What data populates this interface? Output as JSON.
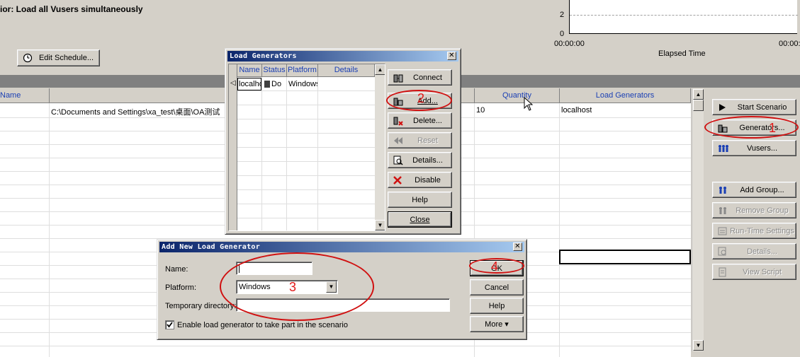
{
  "scenario_title": "ior: Load all Vusers simultaneously",
  "edit_schedule_label": "Edit Schedule...",
  "graph": {
    "y_ticks": [
      "2",
      "0"
    ],
    "x_ticks": [
      "00:00:00",
      "00:00:"
    ],
    "xlabel": "Elapsed Time"
  },
  "grid": {
    "columns": [
      "Name",
      "",
      "Quantity",
      "Load Generators"
    ],
    "row1": {
      "path": "C:\\Documents and Settings\\xa_test\\桌面\\OA测试",
      "quantity": "10",
      "load_generator": "localhost"
    }
  },
  "side_buttons": {
    "start_scenario": "Start Scenario",
    "generators": "Generators...",
    "vusers": "Vusers...",
    "add_group": "Add Group...",
    "remove_group": "Remove Group",
    "runtime_settings": "Run-Time Settings",
    "details": "Details...",
    "view_script": "View Script"
  },
  "load_generators_dialog": {
    "title": "Load Generators",
    "columns": [
      "Name",
      "Status",
      "Platform",
      "Details"
    ],
    "row": {
      "name": "localhost",
      "status": "Do",
      "platform": "Windows",
      "details": ""
    },
    "buttons": {
      "connect": "Connect",
      "add": "Add...",
      "delete": "Delete...",
      "reset": "Reset",
      "details": "Details...",
      "disable": "Disable",
      "help": "Help",
      "close": "Close"
    }
  },
  "add_generator_dialog": {
    "title": "Add New Load Generator",
    "name_label": "Name:",
    "name_value": "",
    "platform_label": "Platform:",
    "platform_value": "Windows",
    "tempdir_label": "Temporary directory:",
    "tempdir_value": "",
    "checkbox_label": "Enable load generator to take part in the scenario",
    "checkbox_checked": true,
    "buttons": {
      "ok": "OK",
      "cancel": "Cancel",
      "help": "Help",
      "more": "More ▾"
    }
  },
  "annotations": {
    "one": "1",
    "two": "2",
    "three": "3",
    "four": "4"
  },
  "colors": {
    "title_bar": "#0a246a",
    "accent_blue": "#1a3fb4",
    "annotation_red": "#d01010"
  }
}
